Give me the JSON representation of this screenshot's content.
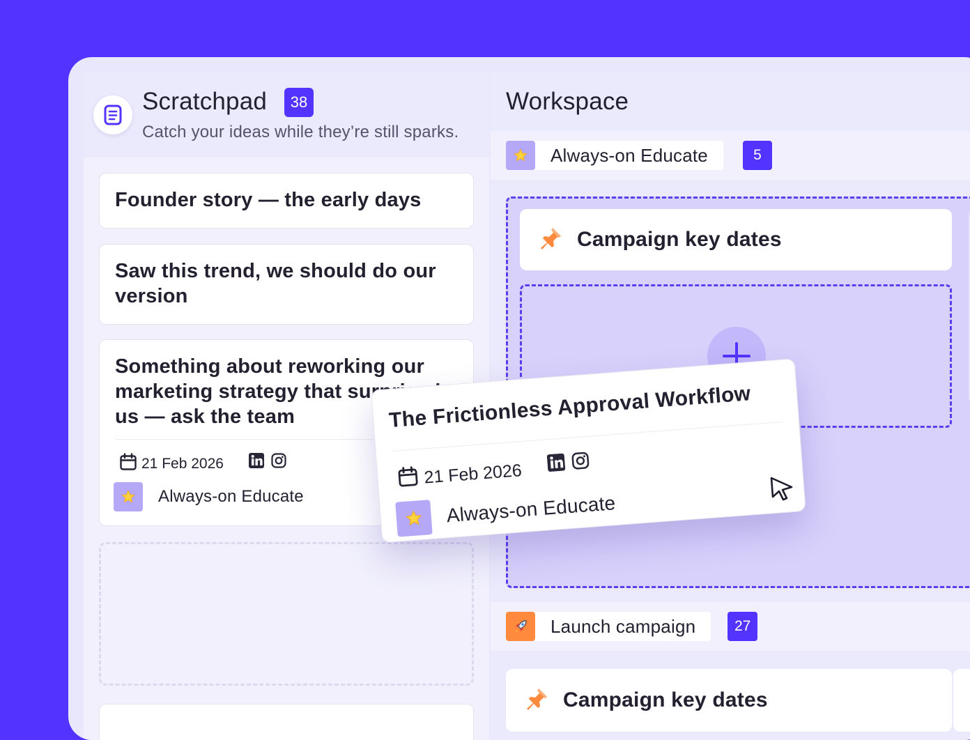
{
  "colors": {
    "accent": "#5233ff",
    "tag": "#b5a8f7",
    "rocket": "#ff8a3d",
    "dropzone": "#d8d1fb"
  },
  "scratchpad": {
    "icon": "document-icon",
    "title": "Scratchpad",
    "count": "38",
    "subtitle": "Catch your ideas while they’re still sparks.",
    "notes": [
      {
        "text": "Founder story — the early days"
      },
      {
        "text": "Saw this trend, we should do our version"
      },
      {
        "text": "Something about reworking our marketing strategy that surprised us — ask the team",
        "date": "21 Feb 2026",
        "socials": [
          "linkedin-icon",
          "instagram-icon"
        ],
        "tag": {
          "icon": "star-icon",
          "label": "Always-on Educate"
        }
      }
    ]
  },
  "workspace": {
    "title": "Workspace",
    "groups": [
      {
        "icon": "star-icon",
        "label": "Always-on Educate",
        "count": "5",
        "cards": [
          {
            "icon": "pushpin-icon",
            "label": "Campaign key dates"
          }
        ],
        "add_button": "add-icon"
      },
      {
        "icon": "rocket-icon",
        "label": "Launch campaign",
        "count": "27",
        "cards": [
          {
            "icon": "pushpin-icon",
            "label": "Campaign key dates"
          }
        ]
      }
    ]
  },
  "dragged_card": {
    "title": "The Frictionless Approval Workflow",
    "date": "21 Feb 2026",
    "socials": [
      "linkedin-icon",
      "instagram-icon"
    ],
    "tag": {
      "icon": "star-icon",
      "label": "Always-on Educate"
    }
  },
  "cursor": "pointer-cursor-icon"
}
